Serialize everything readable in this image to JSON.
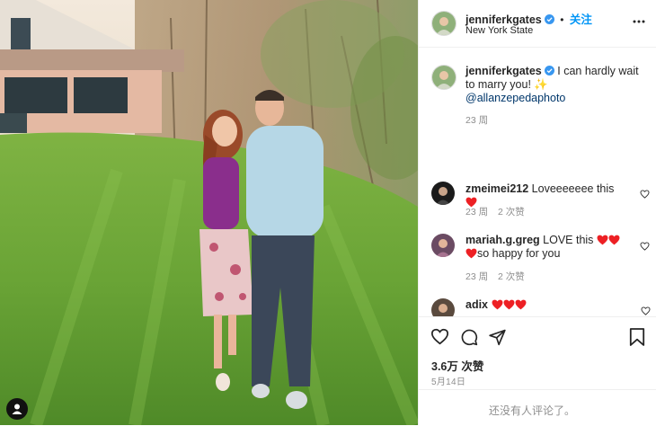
{
  "post": {
    "username": "jenniferkgates",
    "follow_label": "关注",
    "location": "New York State",
    "more_icon": "more-horizontal-icon"
  },
  "caption": {
    "username": "jenniferkgates",
    "text": "I can hardly wait to marry you!",
    "emoji": "✨",
    "mention": "@allanzepedaphoto",
    "time": "23 周"
  },
  "comments": [
    {
      "username": "zmeimei212",
      "text": "Loveeeeeee this",
      "hearts": 1,
      "tail": "",
      "time": "23 周",
      "replies": "2 次赞"
    },
    {
      "username": "mariah.g.greg",
      "text": "LOVE this",
      "hearts": 3,
      "tail": "so happy for you",
      "time": "23 周",
      "replies": "2 次赞"
    },
    {
      "username": "adix",
      "text": "",
      "hearts": 3,
      "tail": "",
      "time": "",
      "replies": ""
    }
  ],
  "stats": {
    "likes": "3.6万 次赞",
    "date": "5月14日"
  },
  "comment_box": {
    "placeholder": "还没有人评论了。"
  },
  "colors": {
    "accent": "#0095f6",
    "heart": "#ed2024",
    "link": "#00376b"
  }
}
